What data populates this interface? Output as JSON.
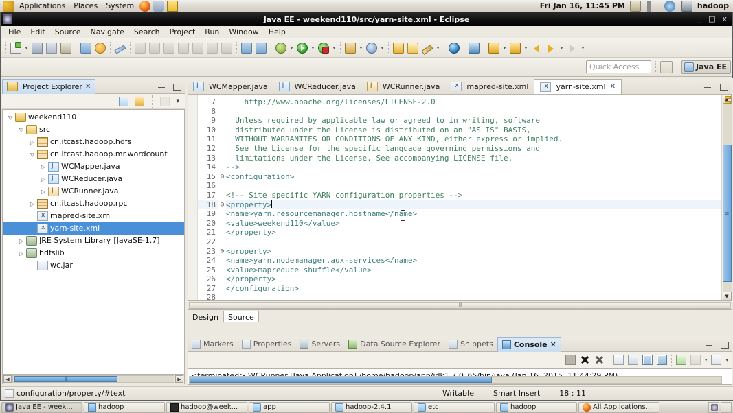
{
  "gnome_panel": {
    "menus": [
      "Applications",
      "Places",
      "System"
    ],
    "launchers": [
      "firefox-icon",
      "help-icon",
      "notes-icon"
    ],
    "clock": "Fri Jan 16, 11:45 PM",
    "tray_icons": [
      "printer-icon",
      "volume-icon",
      "bluetooth-icon",
      "display-icon"
    ],
    "user": "hadoop"
  },
  "window": {
    "title": "Java EE - weekend110/src/yarn-site.xml - Eclipse",
    "minimize": "_",
    "maximize": "□",
    "close": "x"
  },
  "menubar": [
    "File",
    "Edit",
    "Source",
    "Navigate",
    "Search",
    "Project",
    "Run",
    "Window",
    "Help"
  ],
  "toolbar": {
    "groups": [
      {
        "items": [
          {
            "icon": "new-icon",
            "arrow": true
          },
          {
            "icon": "save-icon",
            "arrow": false
          },
          {
            "icon": "save-all-icon",
            "arrow": false
          },
          {
            "icon": "print-icon",
            "arrow": false
          }
        ]
      },
      {
        "items": [
          {
            "icon": "build-icon",
            "arrow": false
          },
          {
            "icon": "refresh-icon",
            "arrow": false
          }
        ]
      },
      {
        "items": [
          {
            "icon": "marker-pen-icon",
            "arrow": false
          }
        ]
      },
      {
        "items": [
          {
            "icon": "resume-icon",
            "arrow": false
          },
          {
            "icon": "suspend-icon",
            "arrow": false
          },
          {
            "icon": "terminate-icon",
            "arrow": false
          },
          {
            "icon": "disconnect-icon",
            "arrow": false
          },
          {
            "icon": "step-into-icon",
            "arrow": false
          },
          {
            "icon": "step-over-icon",
            "arrow": false
          },
          {
            "icon": "step-return-icon",
            "arrow": false
          }
        ]
      },
      {
        "items": [
          {
            "icon": "list-icon",
            "arrow": false
          },
          {
            "icon": "filter-icon",
            "arrow": false
          }
        ]
      },
      {
        "items": [
          {
            "icon": "debug-bug-icon",
            "arrow": true
          },
          {
            "icon": "run-icon",
            "arrow": true
          },
          {
            "icon": "run-config-icon",
            "arrow": true
          }
        ]
      },
      {
        "items": [
          {
            "icon": "new-java-package-icon",
            "arrow": true
          },
          {
            "icon": "new-server-icon",
            "arrow": true
          }
        ]
      },
      {
        "items": [
          {
            "icon": "open-type-icon",
            "arrow": false
          },
          {
            "icon": "open-resource-icon",
            "arrow": false
          },
          {
            "icon": "quick-fix-icon",
            "arrow": true
          }
        ]
      },
      {
        "items": [
          {
            "icon": "web-browser-icon",
            "arrow": false
          }
        ]
      },
      {
        "items": [
          {
            "icon": "export-wizard-icon",
            "arrow": false
          }
        ]
      },
      {
        "items": [
          {
            "icon": "next-annotation-icon",
            "arrow": true
          },
          {
            "icon": "previous-annotation-icon",
            "arrow": true
          }
        ]
      },
      {
        "items": [
          {
            "icon": "back-icon",
            "arrow": false
          },
          {
            "icon": "forward-icon",
            "arrow": true
          },
          {
            "icon": "forward-disabled-icon",
            "arrow": true
          }
        ]
      }
    ]
  },
  "quick_access": {
    "placeholder": "Quick Access",
    "value": "",
    "open_perspective_icon": "open-perspective-icon",
    "perspective_label": "Java EE"
  },
  "project_explorer": {
    "title": "Project Explorer",
    "close_glyph": "✕",
    "toolbar_icons": [
      "collapse-all-icon",
      "link-with-editor-icon",
      "focus-icon",
      "view-menu-icon"
    ],
    "tree": [
      {
        "indent": 0,
        "twisty": "▽",
        "icon": "project-icon",
        "label": "weekend110",
        "suffix": "",
        "selected": false
      },
      {
        "indent": 1,
        "twisty": "▽",
        "icon": "source-folder-icon",
        "label": "src",
        "suffix": "",
        "selected": false
      },
      {
        "indent": 2,
        "twisty": "▷",
        "icon": "package-icon",
        "label": "cn.itcast.hadoop.hdfs",
        "suffix": "",
        "selected": false
      },
      {
        "indent": 2,
        "twisty": "▽",
        "icon": "package-icon",
        "label": "cn.itcast.hadoop.mr.wordcount",
        "suffix": "",
        "selected": false
      },
      {
        "indent": 3,
        "twisty": "▷",
        "icon": "java-file-icon",
        "label": "WCMapper.java",
        "suffix": "",
        "selected": false
      },
      {
        "indent": 3,
        "twisty": "▷",
        "icon": "java-file-icon",
        "label": "WCReducer.java",
        "suffix": "",
        "selected": false
      },
      {
        "indent": 3,
        "twisty": "▷",
        "icon": "java-main-file-icon",
        "label": "WCRunner.java",
        "suffix": "",
        "selected": false
      },
      {
        "indent": 2,
        "twisty": "▷",
        "icon": "package-icon",
        "label": "cn.itcast.hadoop.rpc",
        "suffix": "",
        "selected": false
      },
      {
        "indent": 2,
        "twisty": "",
        "icon": "xml-file-icon",
        "label": "mapred-site.xml",
        "suffix": "",
        "selected": false
      },
      {
        "indent": 2,
        "twisty": "",
        "icon": "xml-file-icon",
        "label": "yarn-site.xml",
        "suffix": "",
        "selected": true
      },
      {
        "indent": 1,
        "twisty": "▷",
        "icon": "library-icon",
        "label": "JRE System Library",
        "suffix": "[JavaSE-1.7]",
        "selected": false
      },
      {
        "indent": 1,
        "twisty": "▷",
        "icon": "library-icon",
        "label": "hdfslib",
        "suffix": "",
        "selected": false
      },
      {
        "indent": 1,
        "twisty": "",
        "icon": "jar-file-icon",
        "label": "wc.jar",
        "suffix": "",
        "selected": false
      }
    ]
  },
  "editor": {
    "tabs": [
      {
        "label": "WCMapper.java",
        "icon": "java-file-icon",
        "active": false,
        "close": ""
      },
      {
        "label": "WCReducer.java",
        "icon": "java-file-icon",
        "active": false,
        "close": ""
      },
      {
        "label": "WCRunner.java",
        "icon": "java-main-file-icon",
        "active": false,
        "close": ""
      },
      {
        "label": "mapred-site.xml",
        "icon": "xml-file-icon",
        "active": false,
        "close": ""
      },
      {
        "label": "yarn-site.xml",
        "icon": "xml-file-icon",
        "active": true,
        "close": "✕"
      }
    ],
    "lines": [
      {
        "num": "7",
        "fold": "",
        "text": "    http://www.apache.org/licenses/LICENSE-2.0",
        "cls": "tok-cmt",
        "cur": false
      },
      {
        "num": "8",
        "fold": "",
        "text": "",
        "cls": "tok-cmt",
        "cur": false
      },
      {
        "num": "9",
        "fold": "",
        "text": "  Unless required by applicable law or agreed to in writing, software",
        "cls": "tok-cmt",
        "cur": false
      },
      {
        "num": "10",
        "fold": "",
        "text": "  distributed under the License is distributed on an \"AS IS\" BASIS,",
        "cls": "tok-cmt",
        "cur": false
      },
      {
        "num": "11",
        "fold": "",
        "text": "  WITHOUT WARRANTIES OR CONDITIONS OF ANY KIND, either express or implied.",
        "cls": "tok-cmt",
        "cur": false
      },
      {
        "num": "12",
        "fold": "",
        "text": "  See the License for the specific language governing permissions and",
        "cls": "tok-cmt",
        "cur": false
      },
      {
        "num": "13",
        "fold": "",
        "text": "  limitations under the License. See accompanying LICENSE file.",
        "cls": "tok-cmt",
        "cur": false
      },
      {
        "num": "14",
        "fold": "",
        "text": "-->",
        "cls": "tok-cmt",
        "cur": false
      },
      {
        "num": "15",
        "fold": "⊖",
        "text": "<configuration>",
        "cls": "tok-tag",
        "cur": false
      },
      {
        "num": "16",
        "fold": "",
        "text": "",
        "cls": "tok-tag",
        "cur": false
      },
      {
        "num": "17",
        "fold": "",
        "text": "<!-- Site specific YARN configuration properties -->",
        "cls": "tok-cmt",
        "cur": false
      },
      {
        "num": "18",
        "fold": "⊖",
        "text": "<property>",
        "cls": "tok-tag",
        "cur": true
      },
      {
        "num": "19",
        "fold": "",
        "text": "<name>yarn.resourcemanager.hostname</name>",
        "cls": "tok-tag",
        "cur": false
      },
      {
        "num": "20",
        "fold": "",
        "text": "<value>weekend110</value>",
        "cls": "tok-tag",
        "cur": false
      },
      {
        "num": "21",
        "fold": "",
        "text": "</property>",
        "cls": "tok-tag",
        "cur": false
      },
      {
        "num": "22",
        "fold": "",
        "text": "",
        "cls": "tok-tag",
        "cur": false
      },
      {
        "num": "23",
        "fold": "⊖",
        "text": "<property>",
        "cls": "tok-tag",
        "cur": false
      },
      {
        "num": "24",
        "fold": "",
        "text": "<name>yarn.nodemanager.aux-services</name>",
        "cls": "tok-tag",
        "cur": false
      },
      {
        "num": "25",
        "fold": "",
        "text": "<value>mapreduce_shuffle</value>",
        "cls": "tok-tag",
        "cur": false
      },
      {
        "num": "26",
        "fold": "",
        "text": "</property>",
        "cls": "tok-tag",
        "cur": false
      },
      {
        "num": "27",
        "fold": "",
        "text": "</configuration>",
        "cls": "tok-tag",
        "cur": false
      },
      {
        "num": "28",
        "fold": "",
        "text": "",
        "cls": "tok-tag",
        "cur": false
      }
    ],
    "bottom_tabs": [
      {
        "label": "Design",
        "active": false
      },
      {
        "label": "Source",
        "active": true
      }
    ]
  },
  "console_panel": {
    "tabs": [
      {
        "label": "Markers",
        "icon": "markers-icon",
        "active": false,
        "close": ""
      },
      {
        "label": "Properties",
        "icon": "properties-icon",
        "active": false,
        "close": ""
      },
      {
        "label": "Servers",
        "icon": "servers-icon",
        "active": false,
        "close": ""
      },
      {
        "label": "Data Source Explorer",
        "icon": "data-source-icon",
        "active": false,
        "close": ""
      },
      {
        "label": "Snippets",
        "icon": "snippets-icon",
        "active": false,
        "close": ""
      },
      {
        "label": "Console",
        "icon": "console-icon",
        "active": true,
        "close": "✕"
      }
    ],
    "toolbar_icons": [
      "terminate-all-icon",
      "remove-launch-icon",
      "remove-all-launches-icon",
      "clear-console-icon",
      "scroll-lock-icon",
      "pin-console-icon",
      "display-selected-console-icon",
      "open-console-icon",
      "new-console-view-icon"
    ],
    "output": "<terminated> WCRunner [Java Application] /home/hadoop/app/jdk1.7.0_65/bin/java (Jan 16, 2015, 11:44:29 PM)"
  },
  "statusbar": {
    "path": "configuration/property/#text",
    "writable": "Writable",
    "insert_mode": "Smart Insert",
    "position": "18 : 11"
  },
  "taskbar": {
    "items": [
      {
        "label": "Java EE - week...",
        "icon": "eclipse-icon",
        "active": true
      },
      {
        "label": "hadoop",
        "icon": "file-manager-icon",
        "active": false
      },
      {
        "label": "hadoop@week...",
        "icon": "terminal-icon",
        "active": false
      },
      {
        "label": "app",
        "icon": "folder-icon",
        "active": false
      },
      {
        "label": "hadoop-2.4.1",
        "icon": "folder-icon",
        "active": false
      },
      {
        "label": "etc",
        "icon": "folder-icon",
        "active": false
      },
      {
        "label": "hadoop",
        "icon": "folder-icon",
        "active": false
      },
      {
        "label": "All Applications...",
        "icon": "applications-icon",
        "active": false
      }
    ]
  }
}
